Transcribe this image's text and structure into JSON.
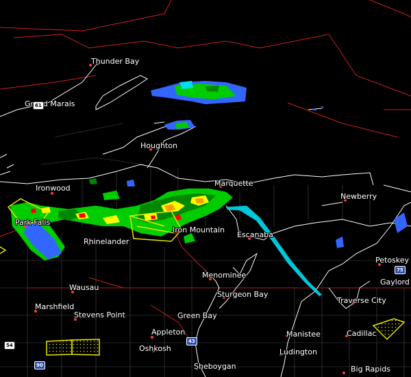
{
  "cities": [
    {
      "id": "thunder-bay",
      "name": "Thunder Bay"
    },
    {
      "id": "grand-marais",
      "name": "Grand Marais"
    },
    {
      "id": "houghton",
      "name": "Houghton"
    },
    {
      "id": "marquette",
      "name": "Marquette"
    },
    {
      "id": "ironwood",
      "name": "Ironwood"
    },
    {
      "id": "newberry",
      "name": "Newberry"
    },
    {
      "id": "park-falls",
      "name": "Park Falls"
    },
    {
      "id": "iron-mountain",
      "name": "Iron Mountain"
    },
    {
      "id": "escanaba",
      "name": "Escanaba"
    },
    {
      "id": "rhinelander",
      "name": "Rhinelander"
    },
    {
      "id": "petoskey",
      "name": "Petoskey"
    },
    {
      "id": "gaylord",
      "name": "Gaylord"
    },
    {
      "id": "menominee",
      "name": "Menominee"
    },
    {
      "id": "wausau",
      "name": "Wausau"
    },
    {
      "id": "sturgeon-bay",
      "name": "Sturgeon Bay"
    },
    {
      "id": "traverse-city",
      "name": "Traverse City"
    },
    {
      "id": "marshfield",
      "name": "Marshfield"
    },
    {
      "id": "stevens-point",
      "name": "Stevens Point"
    },
    {
      "id": "green-bay",
      "name": "Green Bay"
    },
    {
      "id": "appleton",
      "name": "Appleton"
    },
    {
      "id": "manistee",
      "name": "Manistee"
    },
    {
      "id": "cadillac",
      "name": "Cadillac"
    },
    {
      "id": "oshkosh",
      "name": "Oshkosh"
    },
    {
      "id": "ludington",
      "name": "Ludington"
    },
    {
      "id": "sheboygan",
      "name": "Sheboygan"
    },
    {
      "id": "big-rapids",
      "name": "Big Rapids"
    }
  ],
  "route_shields": [
    {
      "id": "i-43",
      "label": "43",
      "type": "interstate"
    },
    {
      "id": "i-75",
      "label": "75",
      "type": "interstate"
    },
    {
      "id": "i-90",
      "label": "90",
      "type": "interstate"
    },
    {
      "id": "us-54",
      "label": "54",
      "type": "us"
    },
    {
      "id": "us-61",
      "label": "61",
      "type": "us"
    }
  ],
  "colors": {
    "background": "#000000",
    "state_border": "#cc2222",
    "county_line": "#5a5a66",
    "shoreline": "#ffffff",
    "warning_polygon": "#e6e600",
    "radar_light": "#00cc00",
    "radar_dark": "#008800",
    "radar_yellow": "#ffff00",
    "radar_orange": "#ff9900",
    "radar_red": "#ff0000",
    "radar_blue": "#3366ff",
    "radar_cyan": "#00ddee"
  }
}
